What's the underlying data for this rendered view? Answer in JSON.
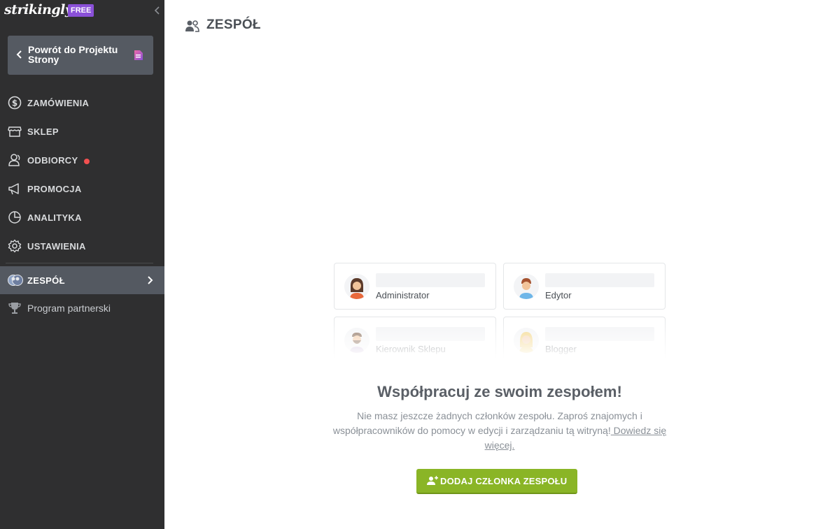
{
  "brand": {
    "name": "strikingly",
    "plan_badge": "FREE"
  },
  "sidebar": {
    "back_button": {
      "label": "Powrót do Projektu Strony"
    },
    "items": [
      {
        "label": "ZAMÓWIENIA",
        "icon": "dollar-circle-icon"
      },
      {
        "label": "SKLEP",
        "icon": "store-icon"
      },
      {
        "label": "ODBIORCY",
        "icon": "contacts-icon",
        "notification_dot": true
      },
      {
        "label": "PROMOCJA",
        "icon": "megaphone-icon"
      },
      {
        "label": "ANALITYKA",
        "icon": "pie-chart-icon"
      },
      {
        "label": "USTAWIENIA",
        "icon": "gear-icon"
      }
    ],
    "active_item": {
      "label": "ZESPÓŁ",
      "icon": "team-icon"
    },
    "partner_item": {
      "label": "Program partnerski",
      "icon": "trophy-icon"
    }
  },
  "main": {
    "title": "ZESPÓŁ",
    "roles": [
      {
        "label": "Administrator",
        "avatar": "woman-avatar-icon"
      },
      {
        "label": "Edytor",
        "avatar": "man-avatar-icon"
      },
      {
        "label": "Kierownik Sklepu",
        "avatar": "bearded-man-avatar-icon"
      },
      {
        "label": "Blogger",
        "avatar": "blonde-woman-avatar-icon"
      }
    ],
    "headline": "Współpracuj ze swoim zespołem!",
    "description": "Nie masz jeszcze żadnych członków zespołu. Zaproś znajomych i współpracowników do pomocy w edycji i zarządzaniu tą witryną!",
    "learn_more": " Dowiedz się więcej.",
    "add_button": "DODAJ CZŁONKA ZESPOŁU"
  },
  "colors": {
    "sidebar_bg": "#2f2f30",
    "active_item_bg": "#545961",
    "badge_purple": "#8a50d8",
    "primary_green": "#8ab526",
    "notification_red": "#f25050"
  }
}
